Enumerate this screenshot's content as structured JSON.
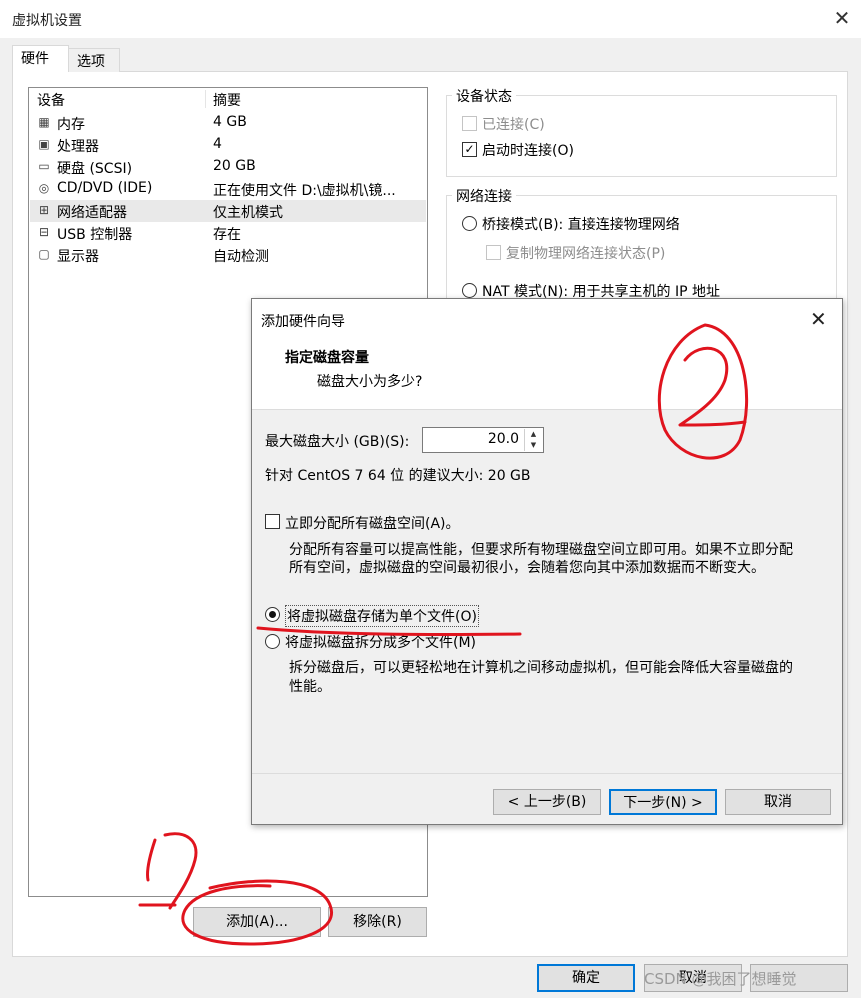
{
  "window": {
    "title": "虚拟机设置"
  },
  "tabs": [
    "硬件",
    "选项"
  ],
  "device_list": {
    "headers": {
      "device": "设备",
      "summary": "摘要"
    },
    "rows": [
      {
        "icon": "memory-icon",
        "glyph": "▦",
        "name": "内存",
        "summary": "4 GB"
      },
      {
        "icon": "cpu-icon",
        "glyph": "▣",
        "name": "处理器",
        "summary": "4"
      },
      {
        "icon": "hard-disk-icon",
        "glyph": "▭",
        "name": "硬盘 (SCSI)",
        "summary": "20 GB"
      },
      {
        "icon": "cd-dvd-icon",
        "glyph": "◎",
        "name": "CD/DVD (IDE)",
        "summary": "正在使用文件 D:\\虚拟机\\镜..."
      },
      {
        "icon": "network-adapter-icon",
        "glyph": "⊞",
        "name": "网络适配器",
        "summary": "仅主机模式"
      },
      {
        "icon": "usb-icon",
        "glyph": "⊟",
        "name": "USB 控制器",
        "summary": "存在"
      },
      {
        "icon": "display-icon",
        "glyph": "▢",
        "name": "显示器",
        "summary": "自动检测"
      }
    ]
  },
  "device_status": {
    "title": "设备状态",
    "connected": "已连接(C)",
    "connect_at_power_on": "启动时连接(O)"
  },
  "network": {
    "title": "网络连接",
    "bridged": "桥接模式(B): 直接连接物理网络",
    "replicate": "复制物理网络连接状态(P)",
    "nat": "NAT 模式(N): 用于共享主机的 IP 地址"
  },
  "buttons": {
    "add": "添加(A)...",
    "remove": "移除(R)",
    "ok": "确定",
    "cancel": "取消"
  },
  "dialog": {
    "title": "添加硬件向导",
    "heading": "指定磁盘容量",
    "subheading": "磁盘大小为多少?",
    "max_size_label": "最大磁盘大小 (GB)(S):",
    "max_size_value": "20.0",
    "recommend": "针对 CentOS 7 64 位 的建议大小: 20 GB",
    "allocate_label": "立即分配所有磁盘空间(A)。",
    "allocate_desc_1": "分配所有容量可以提高性能，但要求所有物理磁盘空间立即可用。如果不立即分配",
    "allocate_desc_2": "所有空间，虚拟磁盘的空间最初很小，会随着您向其中添加数据而不断变大。",
    "single_file": "将虚拟磁盘存储为单个文件(O)",
    "multi_file": "将虚拟磁盘拆分成多个文件(M)",
    "split_desc_1": "拆分磁盘后，可以更轻松地在计算机之间移动虚拟机，但可能会降低大容量磁盘的",
    "split_desc_2": "性能。",
    "back": "< 上一步(B)",
    "next": "下一步(N) >",
    "cancel": "取消"
  },
  "annotations": {
    "step1": "1",
    "step2": "2",
    "color": "#e0141e"
  },
  "watermark": "CSDN @我困了想睡觉"
}
